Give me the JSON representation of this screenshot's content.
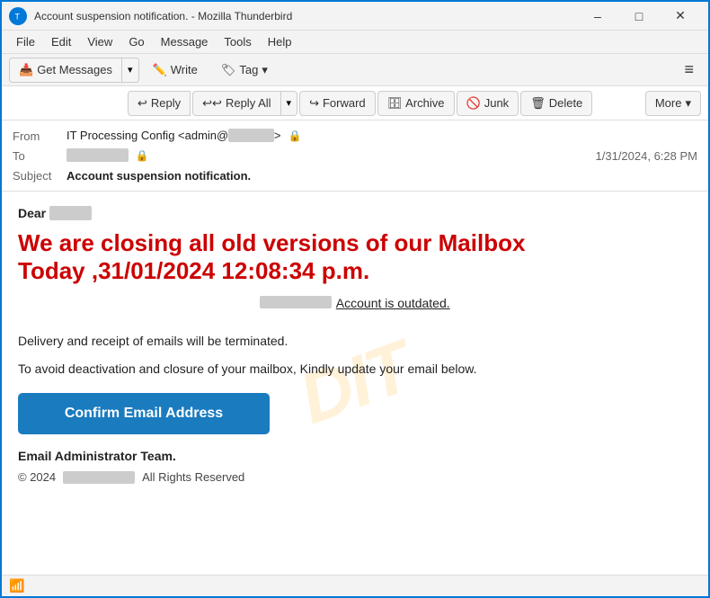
{
  "window": {
    "title": "Account suspension notification. - Mozilla Thunderbird",
    "icon": "thunderbird-icon"
  },
  "titlebar": {
    "minimize": "–",
    "maximize": "□",
    "close": "✕"
  },
  "menubar": {
    "items": [
      "File",
      "Edit",
      "View",
      "Go",
      "Message",
      "Tools",
      "Help"
    ]
  },
  "toolbar": {
    "get_messages_label": "Get Messages",
    "write_label": "Write",
    "tag_label": "Tag",
    "hamburger": "≡"
  },
  "action_toolbar": {
    "reply_label": "Reply",
    "reply_all_label": "Reply All",
    "forward_label": "Forward",
    "archive_label": "Archive",
    "junk_label": "Junk",
    "delete_label": "Delete",
    "more_label": "More"
  },
  "email": {
    "from_label": "From",
    "from_name": "IT Processing Config <admin@",
    "from_blurred": "          ",
    "to_label": "To",
    "to_blurred": "               ",
    "date": "1/31/2024, 6:28 PM",
    "subject_label": "Subject",
    "subject_prefix": "",
    "subject_text": "Account suspension notification.",
    "dear_prefix": "Dear",
    "dear_name": "          ",
    "main_heading_line1": "We are closing all old versions of our Mailbox",
    "main_heading_line2": "Today  ,31/01/2024 12:08:34 p.m.",
    "outdated_text": "Account is outdated.",
    "body_line1": "Delivery and receipt of emails will be terminated.",
    "body_line2": "To avoid deactivation and closure   of your mailbox, Kindly update your email below.",
    "confirm_btn_label": "Confirm Email Address",
    "footer_team": "Email Administrator Team.",
    "copyright_year": "© 2024",
    "copyright_company_blurred": "           ",
    "copyright_rights": "All Rights Reserved"
  },
  "statusbar": {
    "wifi_icon": "📶"
  },
  "watermark": {
    "text": "DIT"
  }
}
